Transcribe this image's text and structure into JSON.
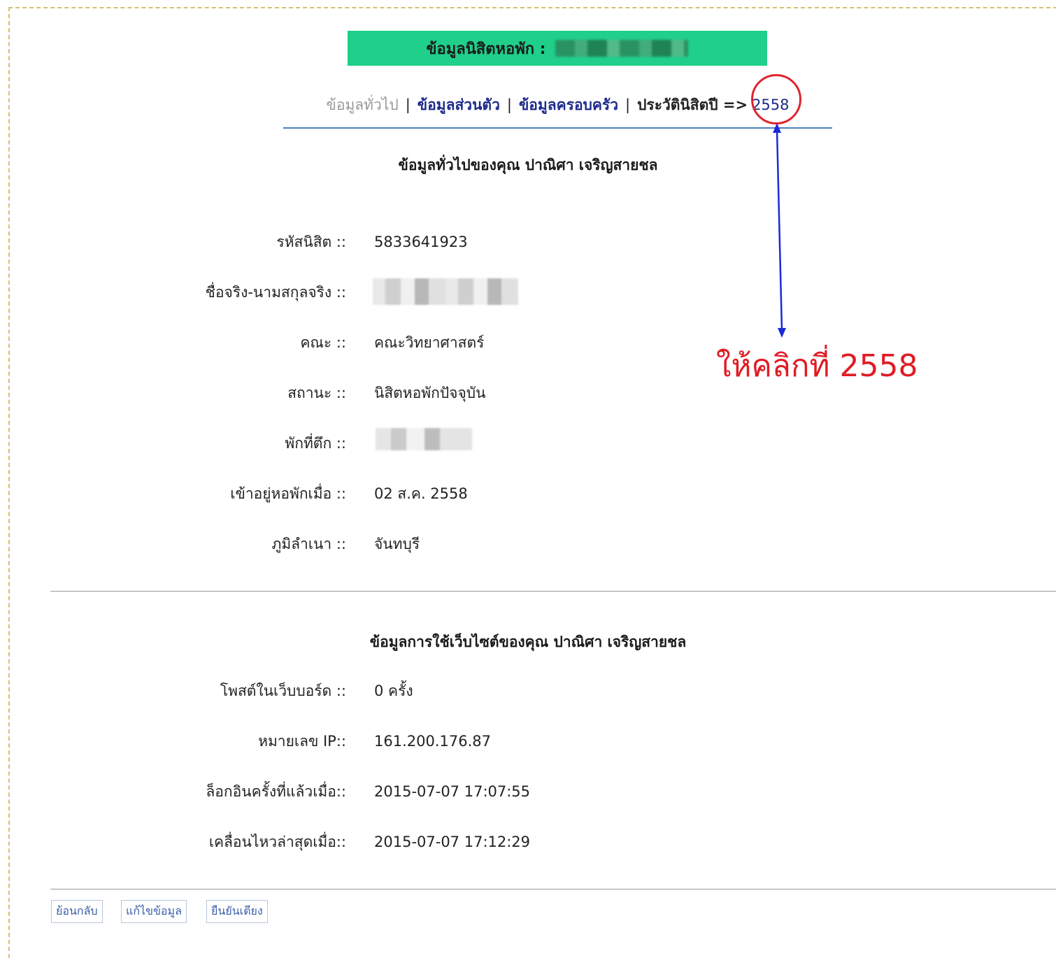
{
  "banner": {
    "title": "ข้อมูลนิสิตหอพัก :"
  },
  "nav": {
    "general": "ข้อมูลทั่วไป",
    "sep": "|",
    "personal": "ข้อมูลส่วนตัว",
    "family": "ข้อมูลครอบครัว",
    "history": "ประวัตินิสิตปี =>",
    "year": "2558"
  },
  "annotation": {
    "text": "ให้คลิกที่ 2558"
  },
  "general_section": {
    "title": "ข้อมูลทั่วไปของคุณ ปาณิศา เจริญสายชล",
    "fields": [
      {
        "label": "รหัสนิสิต ::",
        "value": "5833641923"
      },
      {
        "label": "ชื่อจริง-นามสกุลจริง ::",
        "value": ""
      },
      {
        "label": "คณะ ::",
        "value": "คณะวิทยาศาสตร์"
      },
      {
        "label": "สถานะ ::",
        "value": "นิสิตหอพักปัจจุบัน"
      },
      {
        "label": "พักที่ตึก ::",
        "value": ""
      },
      {
        "label": "เข้าอยู่หอพักเมื่อ ::",
        "value": "02 ส.ค. 2558"
      },
      {
        "label": "ภูมิลำเนา ::",
        "value": "จันทบุรี"
      }
    ]
  },
  "website_section": {
    "title": "ข้อมูลการใช้เว็บไซต์ของคุณ ปาณิศา เจริญสายชล",
    "fields": [
      {
        "label": "โพสต์ในเว็บบอร์ด ::",
        "value": "0 ครั้ง"
      },
      {
        "label": "หมายเลข IP::",
        "value": "161.200.176.87"
      },
      {
        "label": "ล็อกอินครั้งที่แล้วเมื่อ::",
        "value": "2015-07-07 17:07:55"
      },
      {
        "label": "เคลื่อนไหวล่าสุดเมื่อ::",
        "value": "2015-07-07 17:12:29"
      }
    ]
  },
  "buttons": {
    "back": "ย้อนกลับ",
    "edit": "แก้ไขข้อมูล",
    "confirm": "ยืนยันเตียง"
  },
  "colors": {
    "banner": "#1fcf8a",
    "link": "#1d2a8a",
    "annotation": "#e01c24",
    "arrow": "#1a2bd6"
  }
}
